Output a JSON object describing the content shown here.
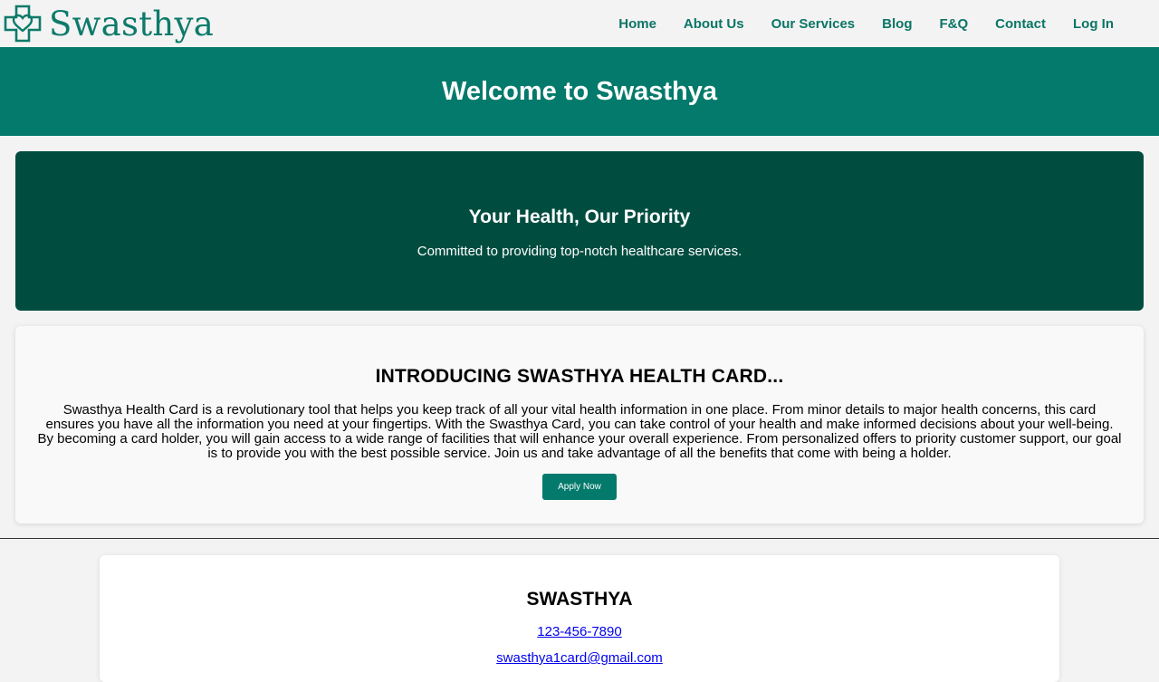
{
  "brand": {
    "name": "Swasthya",
    "logo_icon": "cross-heart-logo-icon",
    "color": "#0d7a6a"
  },
  "nav": {
    "items": [
      "Home",
      "About Us",
      "Our Services",
      "Blog",
      "F&Q",
      "Contact",
      "Log In"
    ]
  },
  "welcome": {
    "title": "Welcome to Swasthya",
    "bg": "#047a6c"
  },
  "hero": {
    "title": "Your Health, Our Priority",
    "subtitle": "Committed to providing top-notch healthcare services.",
    "bg": "#004d40"
  },
  "intro": {
    "title": "INTRODUCING SWASTHYA HEALTH CARD...",
    "body": "Swasthya Health Card is a revolutionary tool that helps you keep track of all your vital health information in one place. From minor details to major health concerns, this card ensures you have all the information you need at your fingertips. With the Swasthya Card, you can take control of your health and make informed decisions about your well-being. By becoming a card holder, you will gain access to a wide range of facilities that will enhance your overall experience. From personalized offers to priority customer support, our goal is to provide you with the best possible service. Join us and take advantage of all the benefits that come with being a holder.",
    "button": "Apply Now"
  },
  "footer": {
    "name": "SWASTHYA",
    "phone": "123-456-7890",
    "email": "swasthya1card@gmail.com"
  }
}
